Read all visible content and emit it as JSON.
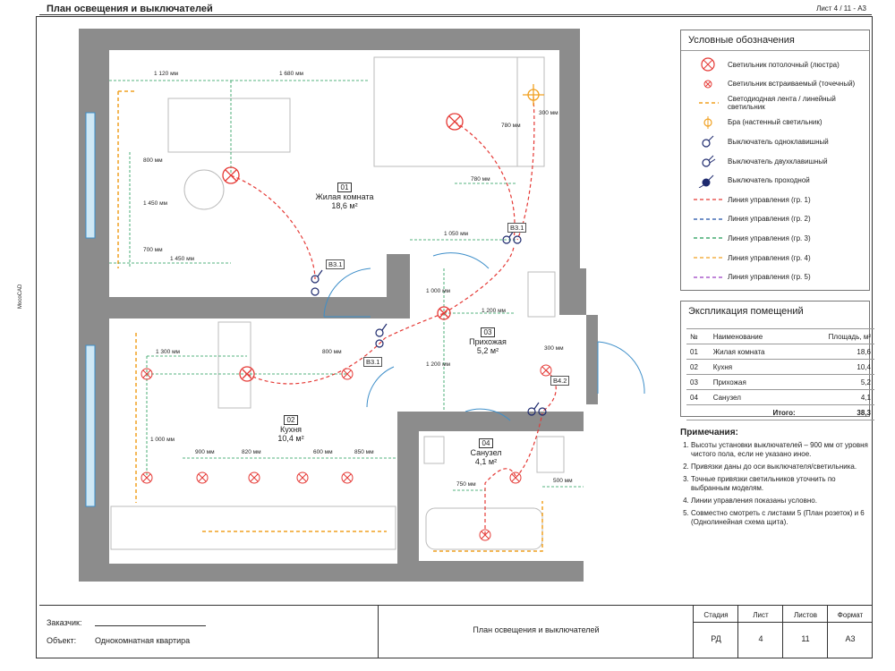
{
  "header": {
    "title": "План освещения и выключателей",
    "sheet": "Лист 4 / 11 - А3",
    "side": "MocoCAD"
  },
  "rooms": [
    {
      "num": "01",
      "name": "Жилая комната",
      "area": "18,6 м²"
    },
    {
      "num": "02",
      "name": "Кухня",
      "area": "10,4 м²"
    },
    {
      "num": "03",
      "name": "Прихожая",
      "area": "5,2 м²"
    },
    {
      "num": "04",
      "name": "Санузел",
      "area": "4,1 м²"
    }
  ],
  "dims": [
    "1 120 мм",
    "1 680 мм",
    "800 мм",
    "1 450 мм",
    "700 мм",
    "1 450 мм",
    "780 мм",
    "300 мм",
    "780 мм",
    "1 050 мм",
    "1 000 мм",
    "1 200 мм",
    "1 200 мм",
    "300 мм",
    "1 300 мм",
    "800 мм",
    "1 000 мм",
    "900 мм",
    "820 мм",
    "600 мм",
    "850 мм",
    "750 мм",
    "500 мм"
  ],
  "tags": [
    "В3.1",
    "В3.1",
    "В3.1",
    "В4.2"
  ],
  "legend": {
    "title": "Условные обозначения",
    "items": [
      {
        "label": "Светильник потолочный (люстра)",
        "kind": "chandelier"
      },
      {
        "label": "Светильник встраиваемый (точечный)",
        "kind": "spot"
      },
      {
        "label": "Светодиодная лента / линейный светильник",
        "kind": "led"
      },
      {
        "label": "Бра (настенный светильник)",
        "kind": "sconce"
      },
      {
        "label": "Выключатель одноклавишный",
        "kind": "sw1"
      },
      {
        "label": "Выключатель двухклавишный",
        "kind": "sw2"
      },
      {
        "label": "Выключатель проходной",
        "kind": "sw3"
      },
      {
        "label": "Линия управления (гр. 1)",
        "kind": "line",
        "color": "#e53935"
      },
      {
        "label": "Линия управления (гр. 2)",
        "kind": "line",
        "color": "#1e4fa8"
      },
      {
        "label": "Линия управления (гр. 3)",
        "kind": "line",
        "color": "#1f9a55"
      },
      {
        "label": "Линия управления (гр. 4)",
        "kind": "line",
        "color": "#f0a020"
      },
      {
        "label": "Линия управления (гр. 5)",
        "kind": "line",
        "color": "#9b3fc2"
      }
    ]
  },
  "explication": {
    "title": "Экспликация помещений",
    "headers": [
      "№",
      "Наименование",
      "Площадь, м²"
    ],
    "rows": [
      [
        "01",
        "Жилая комната",
        "18,6"
      ],
      [
        "02",
        "Кухня",
        "10,4"
      ],
      [
        "03",
        "Прихожая",
        "5,2"
      ],
      [
        "04",
        "Санузел",
        "4,1"
      ]
    ],
    "total_label": "Итого:",
    "total_value": "38,3"
  },
  "notes": {
    "title": "Примечания:",
    "items": [
      "Высоты установки выключателей – 900 мм от уровня чистого пола, если не указано иное.",
      "Привязки даны до оси выключателя/светильника.",
      "Точные привязки светильников уточнить по выбранным моделям.",
      "Линии управления показаны условно.",
      "Совместно смотреть с листами 5 (План розеток) и 6 (Однолинейная схема щита)."
    ]
  },
  "stamp": {
    "customer_label": "Заказчик:",
    "object_label": "Объект:",
    "object_value": "Однокомнатная квартира",
    "title": "План освещения и выключателей",
    "cols": [
      {
        "h": "Стадия",
        "v": "РД"
      },
      {
        "h": "Лист",
        "v": "4"
      },
      {
        "h": "Листов",
        "v": "11"
      },
      {
        "h": "Формат",
        "v": "А3"
      }
    ]
  },
  "colors": {
    "wall": "#8c8c8c",
    "red": "#e53935",
    "green": "#1f9a55",
    "orange": "#f0a020",
    "blue": "#1e4fa8"
  }
}
